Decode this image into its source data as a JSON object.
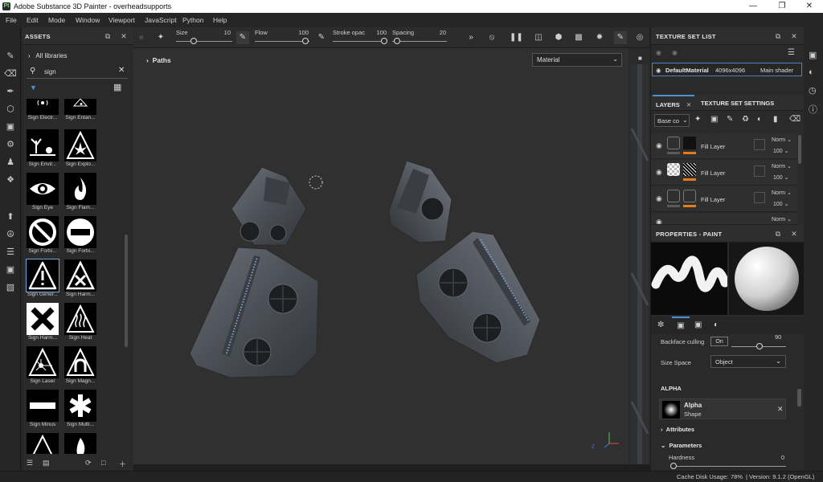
{
  "window": {
    "title": "Adobe Substance 3D Painter - overheadsupports",
    "app_icon": "Pt",
    "controls": [
      "—",
      "❐",
      "✕"
    ]
  },
  "menu": [
    "File",
    "Edit",
    "Mode",
    "Window",
    "Viewport",
    "JavaScript",
    "Python",
    "Help"
  ],
  "assets": {
    "title": "ASSETS",
    "libraries": "All libraries",
    "search_value": "sign",
    "items": [
      {
        "label": "Sign Electr...",
        "icon": "electric-sign-icon"
      },
      {
        "label": "Sign Entan...",
        "icon": "entanglement-sign-icon"
      },
      {
        "label": "Sign Envir...",
        "icon": "environment-sign-icon"
      },
      {
        "label": "Sign Explo...",
        "icon": "explosive-sign-icon"
      },
      {
        "label": "Sign Eye",
        "icon": "eye-sign-icon"
      },
      {
        "label": "Sign Flam...",
        "icon": "flammable-sign-icon"
      },
      {
        "label": "Sign Forbi...",
        "icon": "forbidden-sign-icon"
      },
      {
        "label": "Sign Forbi...",
        "icon": "no-entry-sign-icon"
      },
      {
        "label": "Sign Gener...",
        "icon": "general-warning-sign-icon",
        "selected": true
      },
      {
        "label": "Sign Harm...",
        "icon": "harmful-sign-icon"
      },
      {
        "label": "Sign Harm...",
        "icon": "harmful-cross-sign-icon"
      },
      {
        "label": "Sign Heat",
        "icon": "heat-sign-icon"
      },
      {
        "label": "Sign Laser",
        "icon": "laser-sign-icon"
      },
      {
        "label": "Sign Magn...",
        "icon": "magnetic-sign-icon"
      },
      {
        "label": "Sign Minus",
        "icon": "minus-sign-icon"
      },
      {
        "label": "Sign Multi...",
        "icon": "multi-sign-icon"
      }
    ]
  },
  "toolbar": {
    "size_label": "Size",
    "size_value": "10",
    "flow_label": "Flow",
    "flow_value": "100",
    "stroke_label": "Stroke opac",
    "stroke_value": "100",
    "spacing_label": "Spacing",
    "spacing_value": "20"
  },
  "viewport": {
    "paths_label": "Paths",
    "material_select": "Material"
  },
  "texture_set_list": {
    "title": "TEXTURE SET LIST",
    "name": "DefaultMaterial",
    "resolution": "4096x4096",
    "shader": "Main shader"
  },
  "layers": {
    "tab_layers": "LAYERS",
    "tab_settings": "TEXTURE SET SETTINGS",
    "channel": "Base co",
    "rows": [
      {
        "name": "Fill Layer",
        "blend": "Norm",
        "opacity": "100"
      },
      {
        "name": "Fill Layer",
        "blend": "Norm",
        "opacity": "100"
      },
      {
        "name": "Fill Layer",
        "blend": "Norm",
        "opacity": "100"
      },
      {
        "name": "",
        "blend": "Norm",
        "opacity": ""
      }
    ]
  },
  "properties": {
    "title": "PROPERTIES - PAINT",
    "slider_value": "90",
    "backface_label": "Backface culling",
    "backface_value": "On",
    "size_space_label": "Size Space",
    "size_space_value": "Object",
    "alpha_section": "ALPHA",
    "alpha_name": "Alpha",
    "alpha_sub": "Shape",
    "attributes": "Attributes",
    "parameters": "Parameters",
    "hardness_label": "Hardness",
    "hardness_value": "0"
  },
  "status": {
    "cache_label": "Cache Disk Usage:",
    "cache_value": "78%",
    "version": "| Version: 9.1.2 (OpenGL)"
  },
  "axis": {
    "z": "Z",
    "x": "X"
  }
}
